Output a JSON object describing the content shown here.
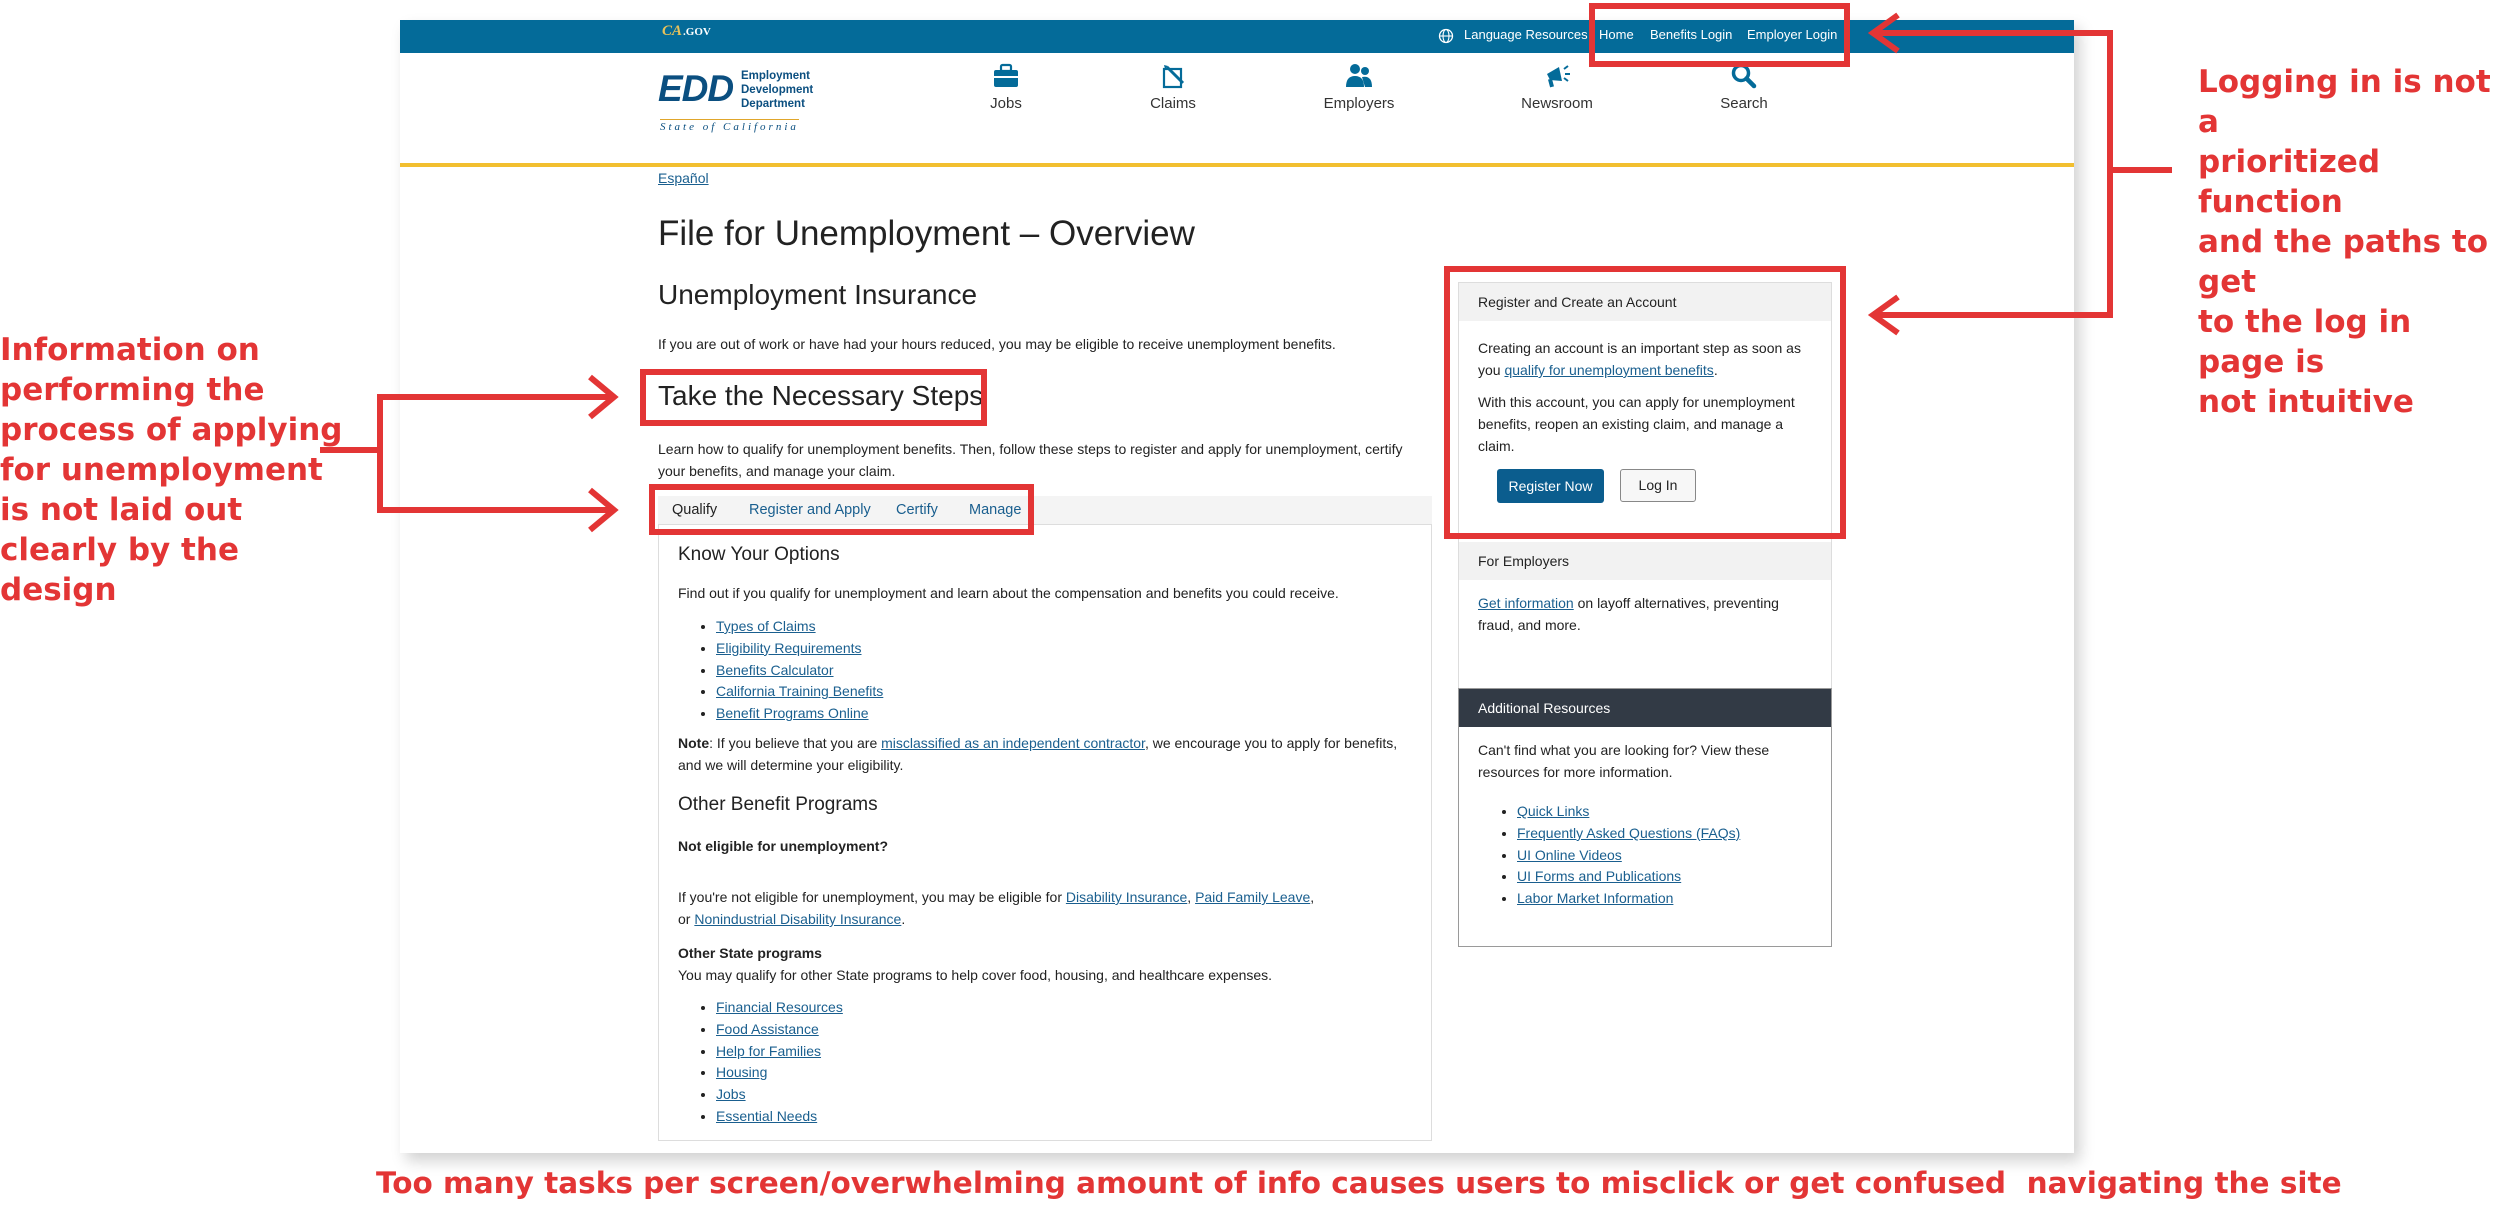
{
  "utility_bar": {
    "ca_gov": "CA",
    "ca_gov_suffix": ".GOV",
    "language_resources": "Language Resources",
    "home": "Home",
    "benefits_login": "Benefits Login",
    "employer_login": "Employer Login"
  },
  "logo": {
    "edd": "EDD",
    "line1": "Employment",
    "line2": "Development",
    "line3": "Department",
    "state": "State of California"
  },
  "nav": [
    {
      "label": "Jobs",
      "icon": "briefcase-icon"
    },
    {
      "label": "Claims",
      "icon": "claims-icon"
    },
    {
      "label": "Employers",
      "icon": "people-icon"
    },
    {
      "label": "Newsroom",
      "icon": "megaphone-icon"
    },
    {
      "label": "Search",
      "icon": "search-icon"
    }
  ],
  "page": {
    "espanol": "Español",
    "title": "File for Unemployment – Overview",
    "ui_heading": "Unemployment Insurance",
    "intro": "If you are out of work or have had your hours reduced, you may be eligible to receive unemployment benefits.",
    "steps_heading": "Take the Necessary Steps",
    "steps_desc": "Learn how to qualify for unemployment benefits. Then, follow these steps to register and apply for unemployment, certify your benefits, and manage your claim."
  },
  "tabs": [
    "Qualify",
    "Register and Apply",
    "Certify",
    "Manage"
  ],
  "qualify_panel": {
    "title": "Know Your Options",
    "text": "Find out if you qualify for unemployment and learn about the compensation and benefits you could receive.",
    "links": [
      "Types of Claims",
      "Eligibility Requirements",
      "Benefits Calculator",
      "California Training Benefits",
      "Benefit Programs Online"
    ],
    "note_label": "Note",
    "note_pre": ": If you believe that you are ",
    "note_link": "misclassified as an independent contractor",
    "note_post": ", we encourage you to apply for benefits,",
    "note_line2": "and we will determine your eligibility.",
    "other_title": "Other Benefit Programs",
    "not_eligible": "Not eligible for unemployment?",
    "ne_pre": "If you're not eligible for unemployment, you may be eligible for ",
    "ne_link1": "Disability Insurance",
    "ne_sep": ", ",
    "ne_link2": "Paid Family Leave",
    "ne_comma": ",",
    "ne_or": "or ",
    "ne_link3": "Nonindustrial Disability Insurance",
    "ne_end": ".",
    "other_state": "Other State programs",
    "other_state_text": "You may qualify for other State programs to help cover food, housing, and healthcare expenses.",
    "state_links": [
      "Financial Resources",
      "Food Assistance",
      "Help for Families",
      "Housing",
      "Jobs",
      "Essential Needs"
    ]
  },
  "register_card": {
    "heading": "Register and Create an Account",
    "p1_pre": "Creating an account is an important step as soon as",
    "p1_you": "you ",
    "p1_link": "qualify for unemployment benefits",
    "p1_end": ".",
    "p2": "With this account, you can apply for unemployment benefits, reopen an existing claim, and manage a claim.",
    "register_btn": "Register Now",
    "login_btn": "Log In"
  },
  "employers_card": {
    "heading": "For Employers",
    "link": "Get information",
    "text_post": " on layoff alternatives, preventing",
    "text_line2": "fraud, and more."
  },
  "resources_card": {
    "heading": "Additional Resources",
    "text": "Can't find what you are looking for? View these resources for more information.",
    "links": [
      "Quick Links",
      "Frequently Asked Questions (FAQs)",
      "UI Online Videos",
      "UI Forms and Publications",
      "Labor Market Information"
    ]
  },
  "annotations": {
    "right": [
      "Logging in is not a",
      "prioritized function",
      "and the paths to get",
      "to the log in page is",
      "not intuitive"
    ],
    "left": [
      "Information on",
      "performing the",
      "process of applying",
      "for unemployment",
      "is not laid out",
      "clearly by the",
      "design"
    ],
    "bottom": "Too many tasks per screen/overwhelming amount of info causes users to misclick or get confused  navigating the site",
    "color": "#e33535"
  },
  "colors": {
    "utility_bar": "#046b99",
    "accent_rule": "#f2bf2f",
    "primary_button": "#0b5d8e",
    "resources_header": "#323a45"
  }
}
